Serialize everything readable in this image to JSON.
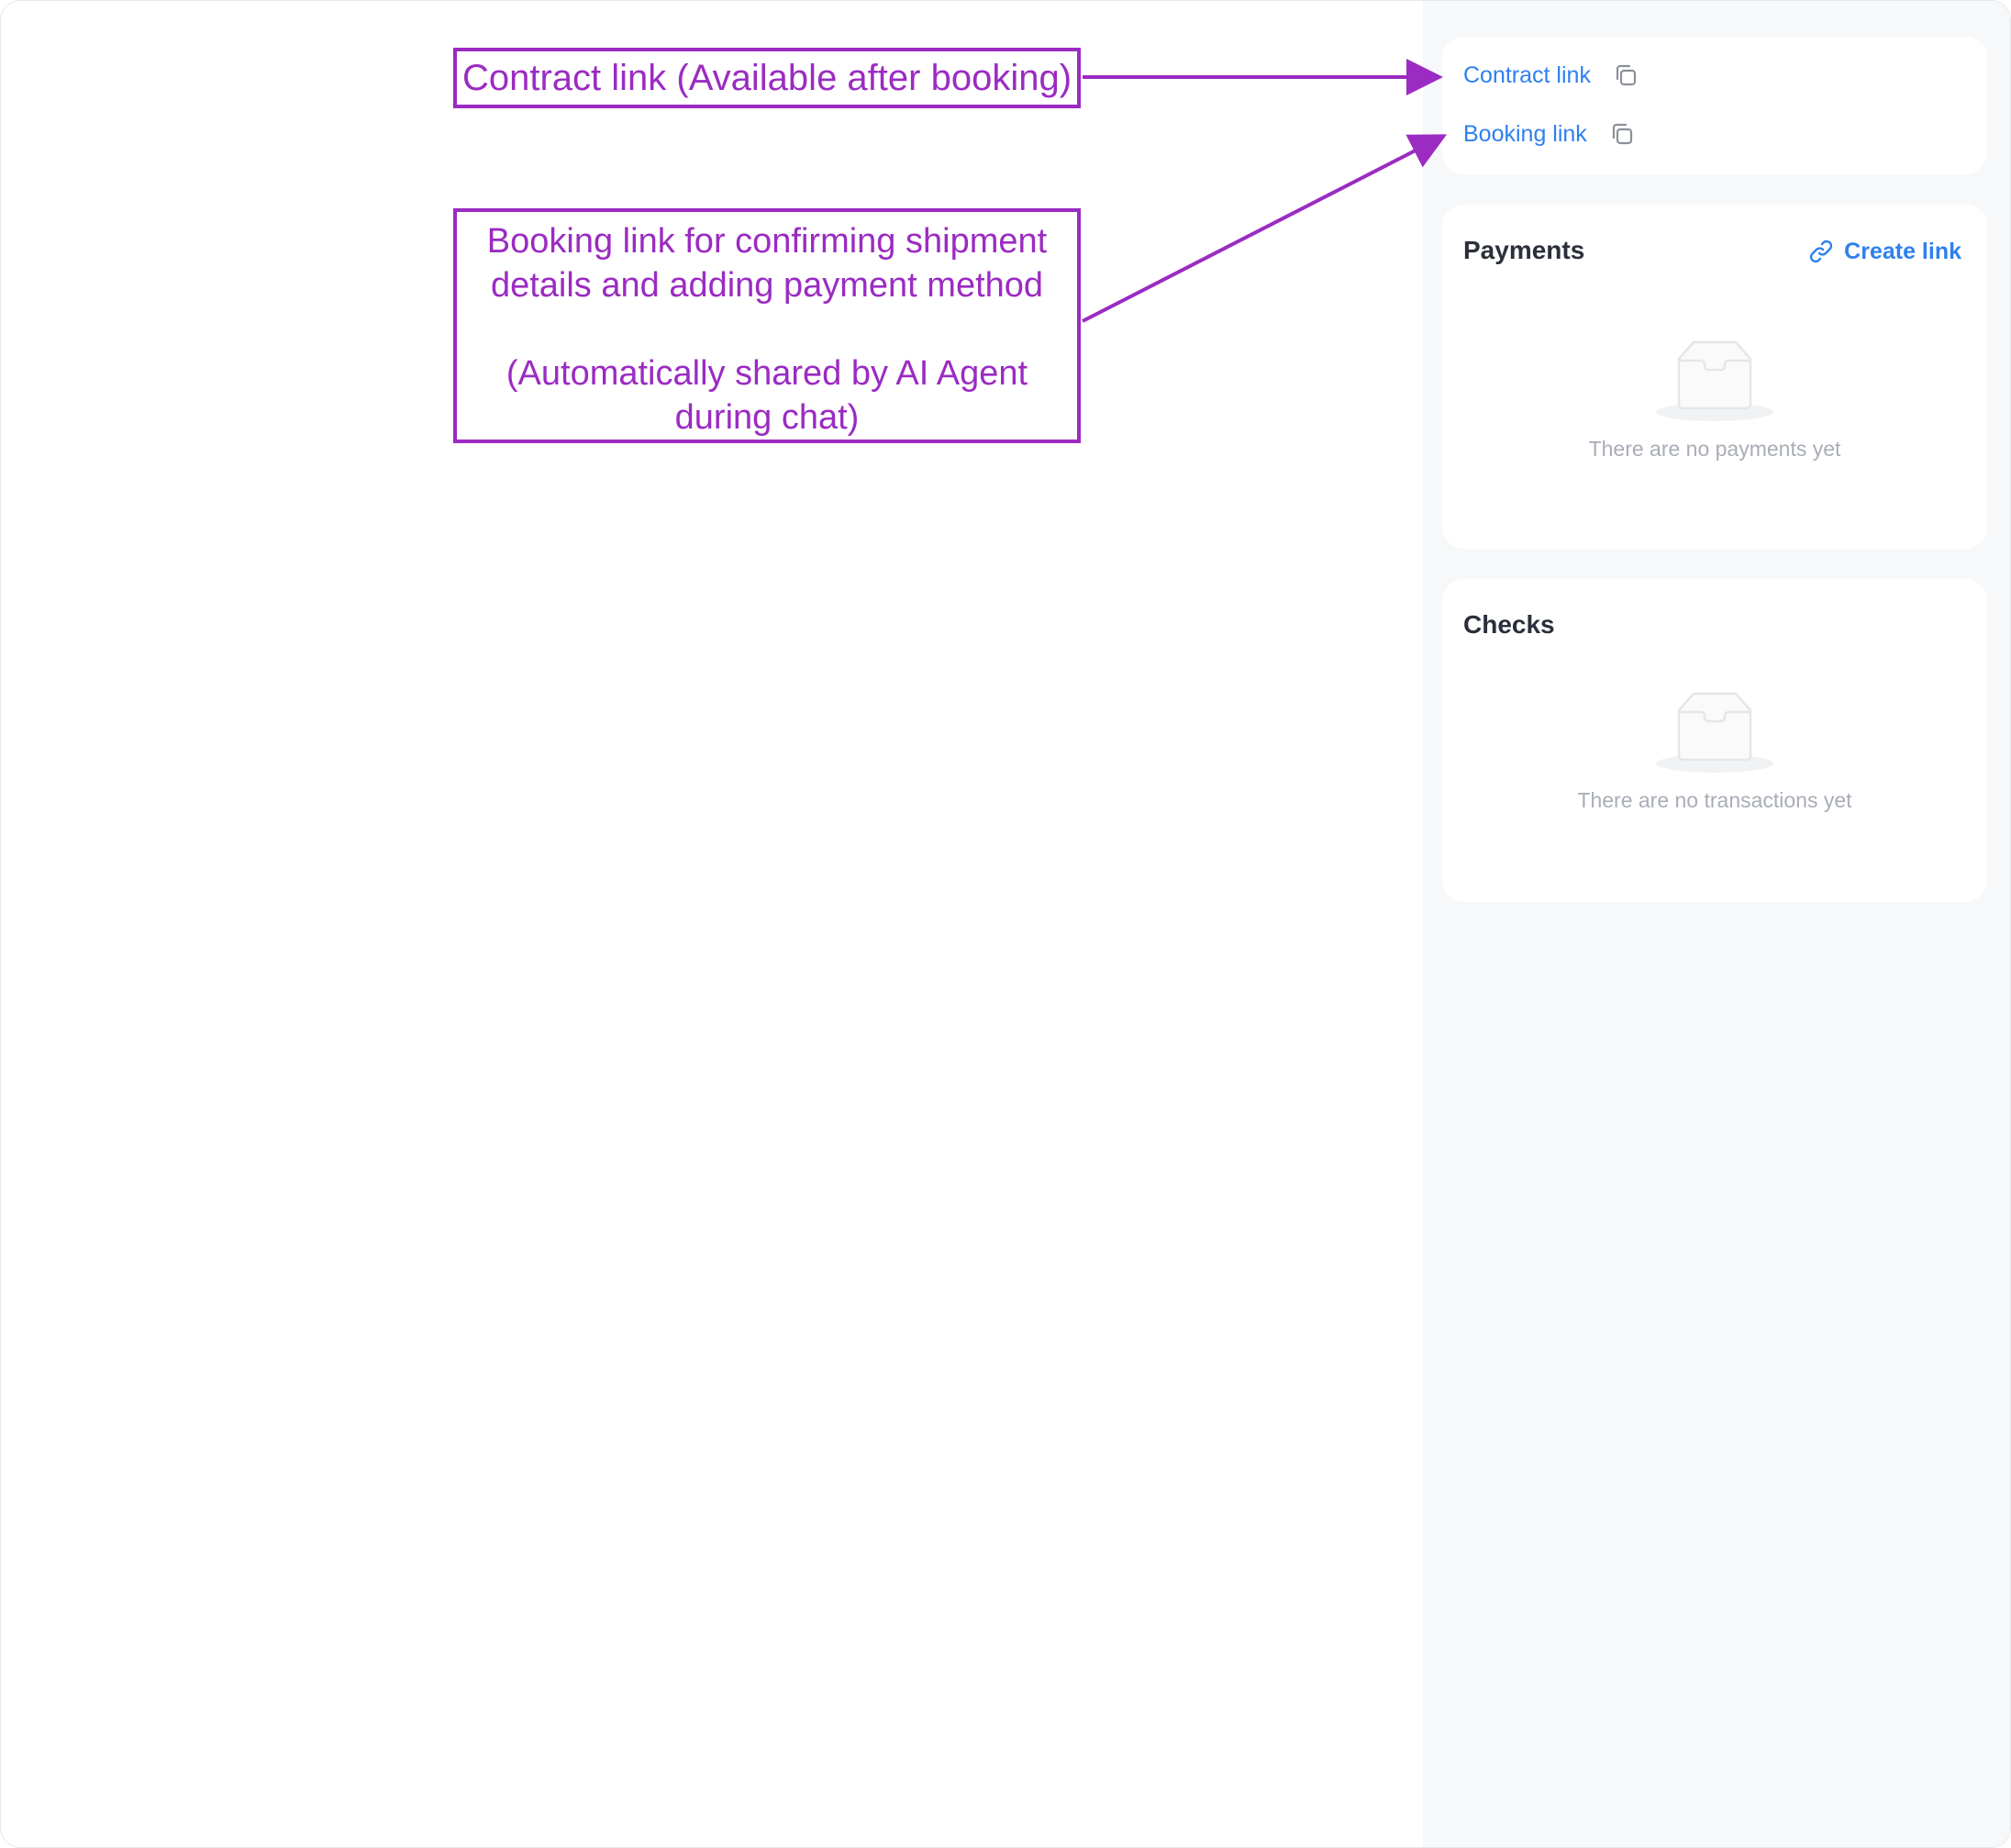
{
  "links_card": {
    "contract_link": {
      "label": "Contract link",
      "icon": "copy-icon"
    },
    "booking_link": {
      "label": "Booking link",
      "icon": "copy-icon"
    }
  },
  "payments": {
    "title": "Payments",
    "create_link_label": "Create link",
    "create_link_icon": "link-icon",
    "empty_icon": "inbox-icon",
    "empty_text": "There are no payments yet"
  },
  "checks": {
    "title": "Checks",
    "empty_icon": "inbox-icon",
    "empty_text": "There are no transactions yet"
  },
  "annotations": {
    "contract": "Contract link (Available after booking)",
    "booking_line1": "Booking link for confirming shipment",
    "booking_line2": "details and adding payment method",
    "booking_line3": "(Automatically shared by AI Agent",
    "booking_line4": "during chat)"
  },
  "colors": {
    "annotation": "#9b2bc2",
    "link_blue": "#2f80ed",
    "panel_bg": "#f7f8fa",
    "muted_text": "#a9adb6"
  }
}
